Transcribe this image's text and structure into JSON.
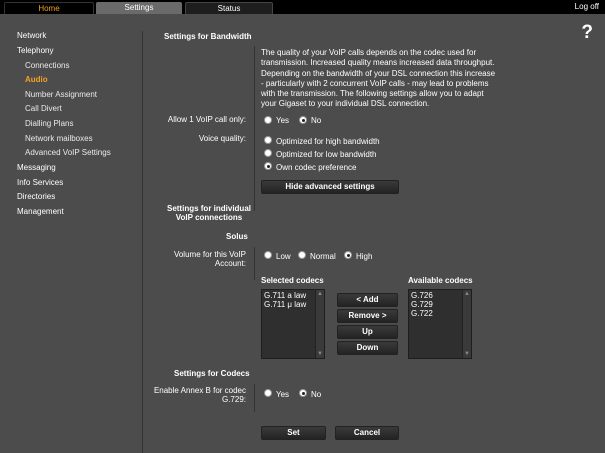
{
  "tabs": {
    "home": "Home",
    "settings": "Settings",
    "status": "Status"
  },
  "logoff": "Log off",
  "help": "?",
  "sidebar": {
    "network": "Network",
    "telephony": "Telephony",
    "connections": "Connections",
    "audio": "Audio",
    "number_assignment": "Number Assignment",
    "call_divert": "Call Divert",
    "dialling_plans": "Dialling Plans",
    "network_mailboxes": "Network mailboxes",
    "advanced_voip": "Advanced VoIP Settings",
    "messaging": "Messaging",
    "info_services": "Info Services",
    "directories": "Directories",
    "management": "Management"
  },
  "bandwidth": {
    "title": "Settings for Bandwidth",
    "description": "The quality of your VoIP calls depends on the codec used for transmission. Increased quality means increased data throughput. Depending on the bandwidth of your DSL connection this increase - particularly with 2 concurrent VoIP calls - may lead to problems with the transmission. The following settings allow you to adapt your Gigaset to your individual DSL connection.",
    "allow_label": "Allow 1 VoIP call only:",
    "allow_yes": "Yes",
    "allow_no": "No",
    "voice_label": "Voice quality:",
    "opt_high": "Optimized for high bandwidth",
    "opt_low": "Optimized for low bandwidth",
    "opt_own": "Own codec preference",
    "hide_button": "Hide advanced settings"
  },
  "individual": {
    "title_line1": "Settings for individual",
    "title_line2": "VoIP connections",
    "account": "Solus",
    "volume_line1": "Volume for this VoIP",
    "volume_line2": "Account:",
    "vol_low": "Low",
    "vol_normal": "Normal",
    "vol_high": "High"
  },
  "codecs": {
    "selected_title": "Selected codecs",
    "available_title": "Available codecs",
    "selected": [
      "G.711 a law",
      "G.711 μ law"
    ],
    "available": [
      "G.726",
      "G.729",
      "G.722"
    ],
    "add": "< Add",
    "remove": "Remove >",
    "up": "Up",
    "down": "Down"
  },
  "codec_settings": {
    "title": "Settings for Codecs",
    "annex_line1": "Enable Annex B for codec",
    "annex_line2": "G.729:",
    "yes": "Yes",
    "no": "No"
  },
  "actions": {
    "set": "Set",
    "cancel": "Cancel"
  },
  "colors": {
    "accent": "#f0a028",
    "background": "#4c4c4c",
    "topbar": "#000000"
  }
}
